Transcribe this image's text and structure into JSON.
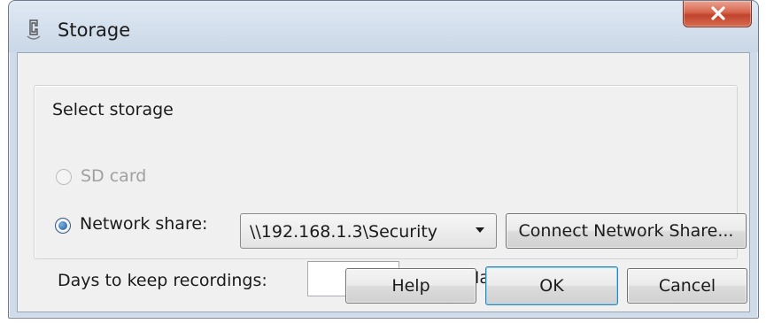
{
  "window": {
    "title": "Storage",
    "close_glyph": "X",
    "icon": "storage-app-icon"
  },
  "group": {
    "caption": "Select storage"
  },
  "sd_card": {
    "label": "SD card",
    "selected": false,
    "enabled": false
  },
  "network_share": {
    "label": "Network share:",
    "selected": true,
    "path": "\\\\192.168.1.3\\Security",
    "connect_label": "Connect Network Share..."
  },
  "retention": {
    "label": "Days to keep recordings:",
    "days_value": "",
    "max_label": "Max",
    "max_checked": true
  },
  "buttons": {
    "help": "Help",
    "ok": "OK",
    "cancel": "Cancel"
  },
  "colors": {
    "close_button": "#c84a33",
    "radio_selected": "#1d5a9a",
    "checkbox_check": "#1f3d6b",
    "default_button_border": "#3c7fb1"
  }
}
